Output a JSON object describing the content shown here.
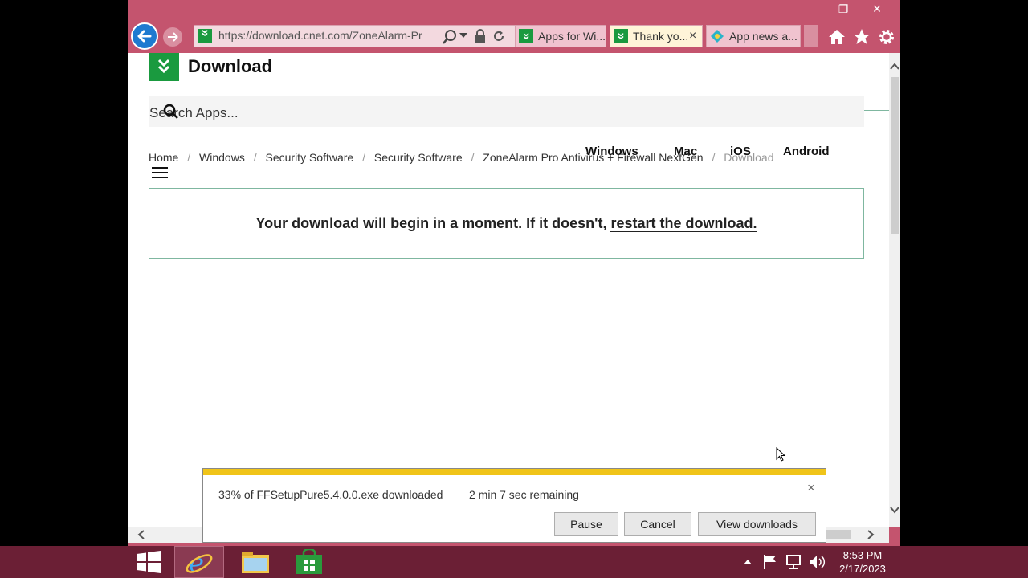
{
  "browser": {
    "address": "https://download.cnet.com/ZoneAlarm-Pr",
    "tabs": [
      {
        "label": "Apps for Wi..."
      },
      {
        "label": "Thank yo..."
      },
      {
        "label": "App news a..."
      }
    ],
    "close_glyph": "×",
    "minimize_glyph": "—",
    "restore_glyph": "❐"
  },
  "site": {
    "brand": "Download",
    "search_placeholder": "Search Apps...",
    "platforms": [
      "Windows",
      "Mac",
      "iOS",
      "Android"
    ],
    "breadcrumb": [
      "Home",
      "Windows",
      "Security Software",
      "Security Software",
      "ZoneAlarm Pro Antivirus + Firewall NextGen",
      "Download"
    ],
    "breadcrumb_sep": "/",
    "message_text": "Your download will begin in a moment. If it doesn't,",
    "message_link": "restart the download."
  },
  "download_bar": {
    "status": "33% of FFSetupPure5.4.0.0.exe downloaded",
    "remaining": "2 min 7 sec remaining",
    "progress": 0.33,
    "pause": "Pause",
    "cancel": "Cancel",
    "view": "View downloads",
    "close": "×"
  },
  "taskbar": {
    "time": "8:53 PM",
    "date": "2/17/2023"
  },
  "colors": {
    "window_chrome": "#c4546e",
    "brand_green": "#1a9a3f",
    "progress_yellow": "#f0c419",
    "taskbar": "#6b1f35"
  }
}
